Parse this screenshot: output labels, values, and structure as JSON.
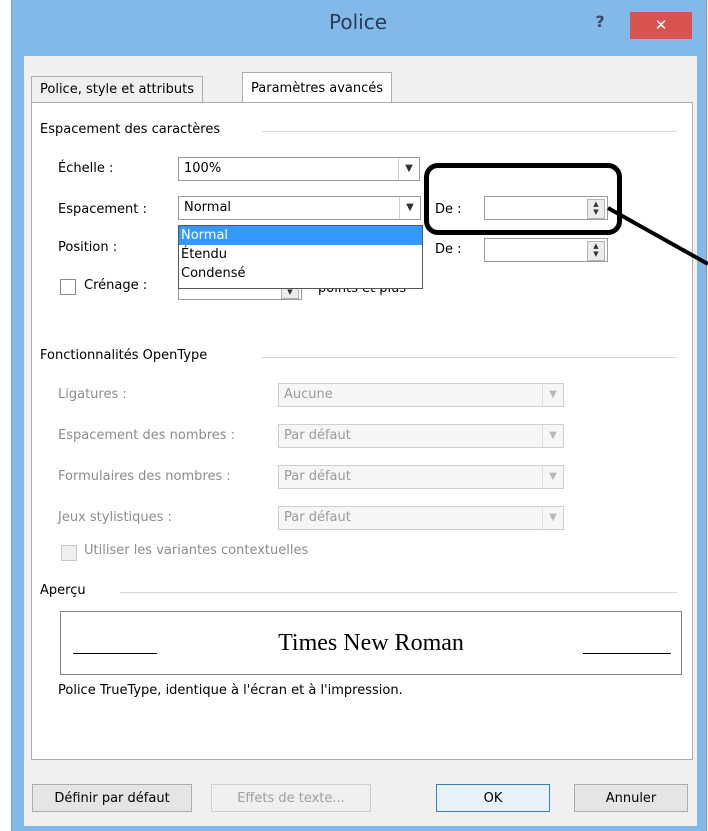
{
  "window": {
    "title": "Police",
    "help_glyph": "?",
    "close_glyph": "✕"
  },
  "tabs": [
    {
      "label": "Police, style et attributs",
      "active": false
    },
    {
      "label": "Paramètres avancés",
      "active": true
    }
  ],
  "char_spacing": {
    "heading": "Espacement des caractères",
    "scale": {
      "label": "Échelle :",
      "value": "100%"
    },
    "spacing": {
      "label": "Espacement :",
      "value": "Normal",
      "by_label": "De :",
      "by_value": ""
    },
    "position": {
      "label": "Position :",
      "by_label": "De :",
      "by_value": ""
    },
    "kerning": {
      "label": "Crénage :",
      "suffix": "points et plus",
      "checked": false
    },
    "spacing_options": [
      "Normal",
      "Étendu",
      "Condensé"
    ],
    "spacing_selected_index": 0
  },
  "opentype": {
    "heading": "Fonctionnalités OpenType",
    "ligatures": {
      "label": "Ligatures :",
      "value": "Aucune"
    },
    "number_spacing": {
      "label": "Espacement des nombres :",
      "value": "Par défaut"
    },
    "number_forms": {
      "label": "Formulaires des nombres :",
      "value": "Par défaut"
    },
    "stylistic_sets": {
      "label": "Jeux stylistiques :",
      "value": "Par défaut"
    },
    "contextual_alternates": {
      "label": "Utiliser les variantes contextuelles",
      "checked": false
    }
  },
  "preview": {
    "heading": "Aperçu",
    "sample": "Times New Roman",
    "description": "Police TrueType, identique à l'écran et à l'impression."
  },
  "buttons": {
    "set_default": "Définir par défaut",
    "text_effects": "Effets de texte...",
    "ok": "OK",
    "cancel": "Annuler"
  },
  "colors": {
    "title_bar": "#83b9e8",
    "close_button": "#d9534f",
    "selection": "#3399ff"
  }
}
